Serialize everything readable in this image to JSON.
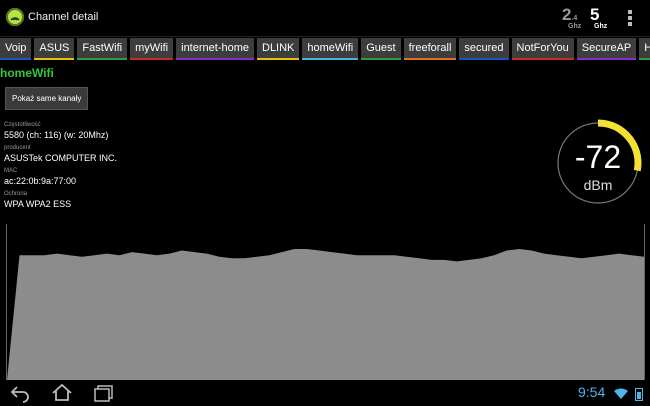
{
  "header": {
    "title": "Channel detail",
    "band_24": {
      "main": "2",
      "sub": ".4",
      "unit": "Ghz"
    },
    "band_5": {
      "main": "5",
      "unit": "Ghz"
    }
  },
  "tabs": [
    {
      "label": "Voip",
      "color": "#1a56c4"
    },
    {
      "label": "ASUS",
      "color": "#e8c000"
    },
    {
      "label": "FastWifi",
      "color": "#2d9a47"
    },
    {
      "label": "myWifi",
      "color": "#cc2a2a"
    },
    {
      "label": "internet-home",
      "color": "#8b2bc9"
    },
    {
      "label": "DLINK",
      "color": "#e8c000"
    },
    {
      "label": "homeWifi",
      "color": "#4ab0e0"
    },
    {
      "label": "Guest",
      "color": "#2d9a47"
    },
    {
      "label": "freeforall",
      "color": "#e07020"
    },
    {
      "label": "secured",
      "color": "#1a56c4"
    },
    {
      "label": "NotForYou",
      "color": "#cc2a2a"
    },
    {
      "label": "SecureAP",
      "color": "#8b2bc9"
    },
    {
      "label": "Hidd",
      "color": "#2d9a47"
    }
  ],
  "network": {
    "name": "homeWifi",
    "same_channels_button": "Pokaż same kanały",
    "frequency_label": "Częstotliwość",
    "frequency_value": "5580 (ch: 116) (w: 20Mhz)",
    "producer_label": "producent",
    "producer_value": "ASUSTek COMPUTER INC.",
    "mac_label": "MAC",
    "mac_value": "ac:22:0b:9a:77:00",
    "security_label": "Ochrona",
    "security_value": "WPA WPA2 ESS"
  },
  "gauge": {
    "value": "-72",
    "unit": "dBm",
    "level": 0.28,
    "track_color": "#777777",
    "fill_color": "#f3e233"
  },
  "chart_data": {
    "type": "area",
    "values": [
      0,
      80,
      80,
      80,
      81,
      80,
      79,
      80,
      81,
      80,
      82,
      81,
      80,
      81,
      83,
      82,
      81,
      79,
      78,
      78,
      79,
      80,
      82,
      84,
      84,
      83,
      82,
      81,
      80,
      80,
      80,
      80,
      79,
      78,
      77,
      77,
      76,
      77,
      78,
      80,
      83,
      84,
      83,
      81,
      80,
      79,
      78,
      79,
      80,
      81,
      80,
      79
    ],
    "ylim": [
      0,
      100
    ],
    "fill": "#8c8c8c"
  },
  "status": {
    "time": "9:54"
  }
}
